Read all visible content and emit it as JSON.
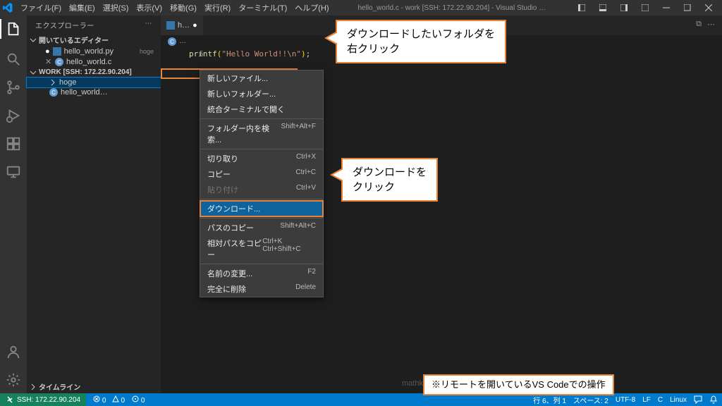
{
  "menubar": {
    "items": [
      "ファイル(F)",
      "編集(E)",
      "選択(S)",
      "表示(V)",
      "移動(G)",
      "実行(R)",
      "ターミナル(T)",
      "ヘルプ(H)"
    ]
  },
  "window_title": "hello_world.c - work [SSH: 172.22.90.204] - Visual Studio …",
  "sidebar": {
    "header": "エクスプローラー",
    "open_editors": "開いているエディター",
    "oe_items": [
      {
        "name": "hello_world.py",
        "tag": "hoge",
        "icon": "py",
        "dot": true
      },
      {
        "name": "hello_world.c",
        "icon": "c",
        "close": true
      }
    ],
    "ws_title": "WORK [SSH: 172.22.90.204]",
    "ws_items": [
      {
        "name": "hoge",
        "folder": true,
        "selected": true
      },
      {
        "name": "hello_world…",
        "icon": "c"
      }
    ],
    "timeline": "タイムライン"
  },
  "tabs": [
    {
      "name": "h…",
      "icon": "py",
      "dot": true
    },
    {
      "name": "…",
      "icon": "c"
    }
  ],
  "breadcrumb": [
    "C",
    "…"
  ],
  "code_line": {
    "n": "6",
    "printf": "printf",
    "str": "\"Hello World!!\\n\""
  },
  "context_menu": {
    "items": [
      {
        "label": "新しいファイル..."
      },
      {
        "label": "新しいフォルダー..."
      },
      {
        "label": "統合ターミナルで開く"
      },
      {
        "sep": true
      },
      {
        "label": "フォルダー内を検索...",
        "sc": "Shift+Alt+F"
      },
      {
        "sep": true
      },
      {
        "label": "切り取り",
        "sc": "Ctrl+X"
      },
      {
        "label": "コピー",
        "sc": "Ctrl+C"
      },
      {
        "label": "貼り付け",
        "sc": "Ctrl+V",
        "disabled": true
      },
      {
        "sep": true
      },
      {
        "label": "ダウンロード...",
        "hl": true
      },
      {
        "sep": true
      },
      {
        "label": "パスのコピー",
        "sc": "Shift+Alt+C"
      },
      {
        "label": "相対パスをコピー",
        "sc": "Ctrl+K Ctrl+Shift+C"
      },
      {
        "sep": true
      },
      {
        "label": "名前の変更...",
        "sc": "F2"
      },
      {
        "label": "完全に削除",
        "sc": "Delete"
      }
    ]
  },
  "callouts": {
    "c1": "ダウンロードしたいフォルダを\n右クリック",
    "c2": "ダウンロードを\nクリック",
    "c3": "※リモートを開いているVS Codeでの操作"
  },
  "statusbar": {
    "remote": "SSH: 172.22.90.204",
    "errors": "0",
    "warnings": "0",
    "ports": "0",
    "pos": "行 6、列 1",
    "spaces": "スペース: 2",
    "enc": "UTF-8",
    "eol": "LF",
    "lang": "C",
    "os": "Linux"
  },
  "watermark": "mathkuro.com"
}
